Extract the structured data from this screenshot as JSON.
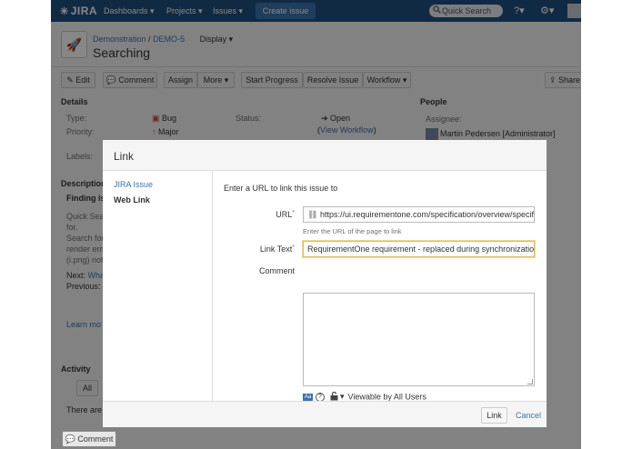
{
  "header": {
    "logo": "JIRA",
    "nav": [
      "Dashboards ▾",
      "Projects ▾",
      "Issues ▾"
    ],
    "create": "Create issue",
    "search_placeholder": "Quick Search"
  },
  "issue": {
    "project": "Demonstration",
    "key": "DEMO-5",
    "display": "Display ▾",
    "title": "Searching"
  },
  "toolbar": {
    "edit": "Edit",
    "comment": "Comment",
    "assign": "Assign",
    "more": "More ▾",
    "start_progress": "Start Progress",
    "resolve": "Resolve Issue",
    "workflow": "Workflow ▾",
    "share": "Share"
  },
  "details": {
    "title": "Details",
    "type_label": "Type:",
    "type_value": "Bug",
    "priority_label": "Priority:",
    "priority_value": "Major",
    "labels_label": "Labels:",
    "status_label": "Status:",
    "status_value": "Open",
    "view_workflow": "(View Workflow)",
    "view_workflow_open": "(",
    "view_workflow_link": "View Workflow",
    "view_workflow_close": ")"
  },
  "people": {
    "title": "People",
    "assignee_label": "Assignee:",
    "assignee_value": "Martin Pedersen [Administrator]"
  },
  "background": {
    "description_title": "Description",
    "finding_prefix": "Finding is",
    "desc_lines": [
      "Quick Sea",
      "for.",
      "Search for",
      "render em",
      "(i.png) not"
    ],
    "next_label": "Next: ",
    "next_link": "What",
    "previous": "Previous: L",
    "learn_more": "Learn mo",
    "activity_title": "Activity",
    "all_tab": "All",
    "there_are": "There are",
    "bottom_comment": "Comment"
  },
  "dialog": {
    "title": "Link",
    "side": {
      "jira_issue": "JIRA Issue",
      "web_link": "Web Link"
    },
    "intro": "Enter a URL to link this issue to",
    "url_label": "URL",
    "url_value": "https://ui.requirementone.com/specification/overview/specificati",
    "url_hint": "Enter the URL of the page to link",
    "link_text_label": "Link Text",
    "link_text_value": "RequirementOne requirement - replaced during synchronization",
    "comment_label": "Comment",
    "visibility": "Viewable by All Users",
    "link_button": "Link",
    "cancel": "Cancel"
  },
  "colors": {
    "header": "#205081",
    "accent": "#3b73af",
    "required": "#d04437"
  }
}
